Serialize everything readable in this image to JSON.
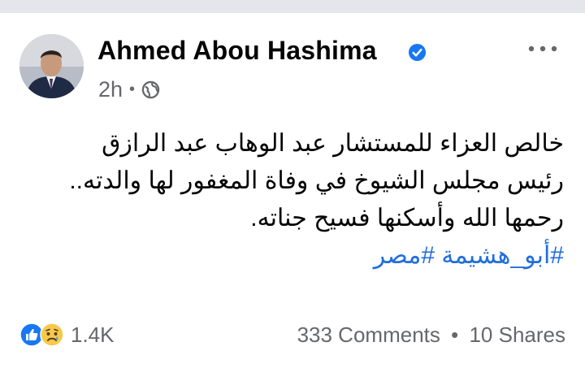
{
  "post": {
    "author": "Ahmed Abou Hashima",
    "time": "2h",
    "separator": "•",
    "lines": [
      "خالص العزاء للمستشار عبد الوهاب عبد الرازق",
      "رئيس مجلس الشيوخ في وفاة المغفور لها والدته..",
      "رحمها الله وأسكنها فسيح جناته."
    ],
    "hashtags": "#أبو_هشيمة #مصر"
  },
  "footer": {
    "reaction_count": "1.4K",
    "comments": "333 Comments",
    "dot": "•",
    "shares": "10 Shares"
  },
  "colors": {
    "link": "#216fdb",
    "secondary_text": "#65676b",
    "verified": "#1877f2"
  },
  "icons": [
    "verified-badge-icon",
    "more-options-icon",
    "globe-icon",
    "like-reaction-icon",
    "sad-reaction-icon"
  ]
}
